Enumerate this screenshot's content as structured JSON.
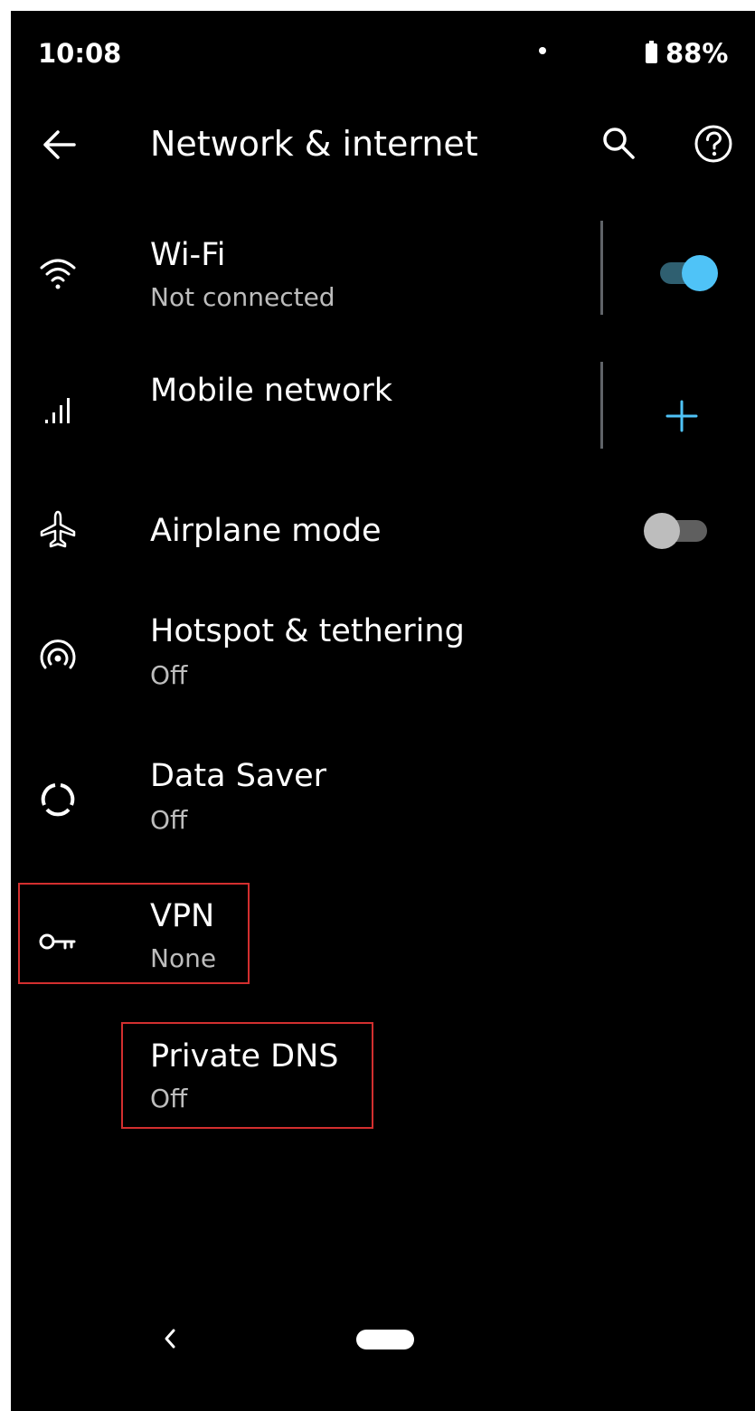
{
  "status_bar": {
    "time": "10:08",
    "battery": "88%"
  },
  "app_bar": {
    "title": "Network & internet",
    "icons": [
      "back-arrow-icon",
      "search-icon",
      "help-icon"
    ]
  },
  "items": [
    {
      "icon": "wifi-icon",
      "title": "Wi-Fi",
      "subtitle": "Not connected",
      "control": "toggle",
      "toggle_on": true
    },
    {
      "icon": "signal-bars-icon",
      "title": "Mobile network",
      "control": "add"
    },
    {
      "icon": "airplane-icon",
      "title": "Airplane mode",
      "control": "toggle",
      "toggle_on": false
    },
    {
      "icon": "hotspot-icon",
      "title": "Hotspot & tethering",
      "subtitle": "Off"
    },
    {
      "icon": "data-saver-icon",
      "title": "Data Saver",
      "subtitle": "Off"
    },
    {
      "icon": "key-icon",
      "title": "VPN",
      "subtitle": "None",
      "highlighted": true
    },
    {
      "title": "Private DNS",
      "subtitle": "Off",
      "highlighted": true
    }
  ],
  "colors": {
    "background": "#000000",
    "accent": "#4fc3f7",
    "toggle_on_track": "#2f5f70",
    "toggle_off_thumb": "#bdbdbd",
    "toggle_off_track": "#5f5f5f",
    "highlight_border": "#d32f2f"
  }
}
